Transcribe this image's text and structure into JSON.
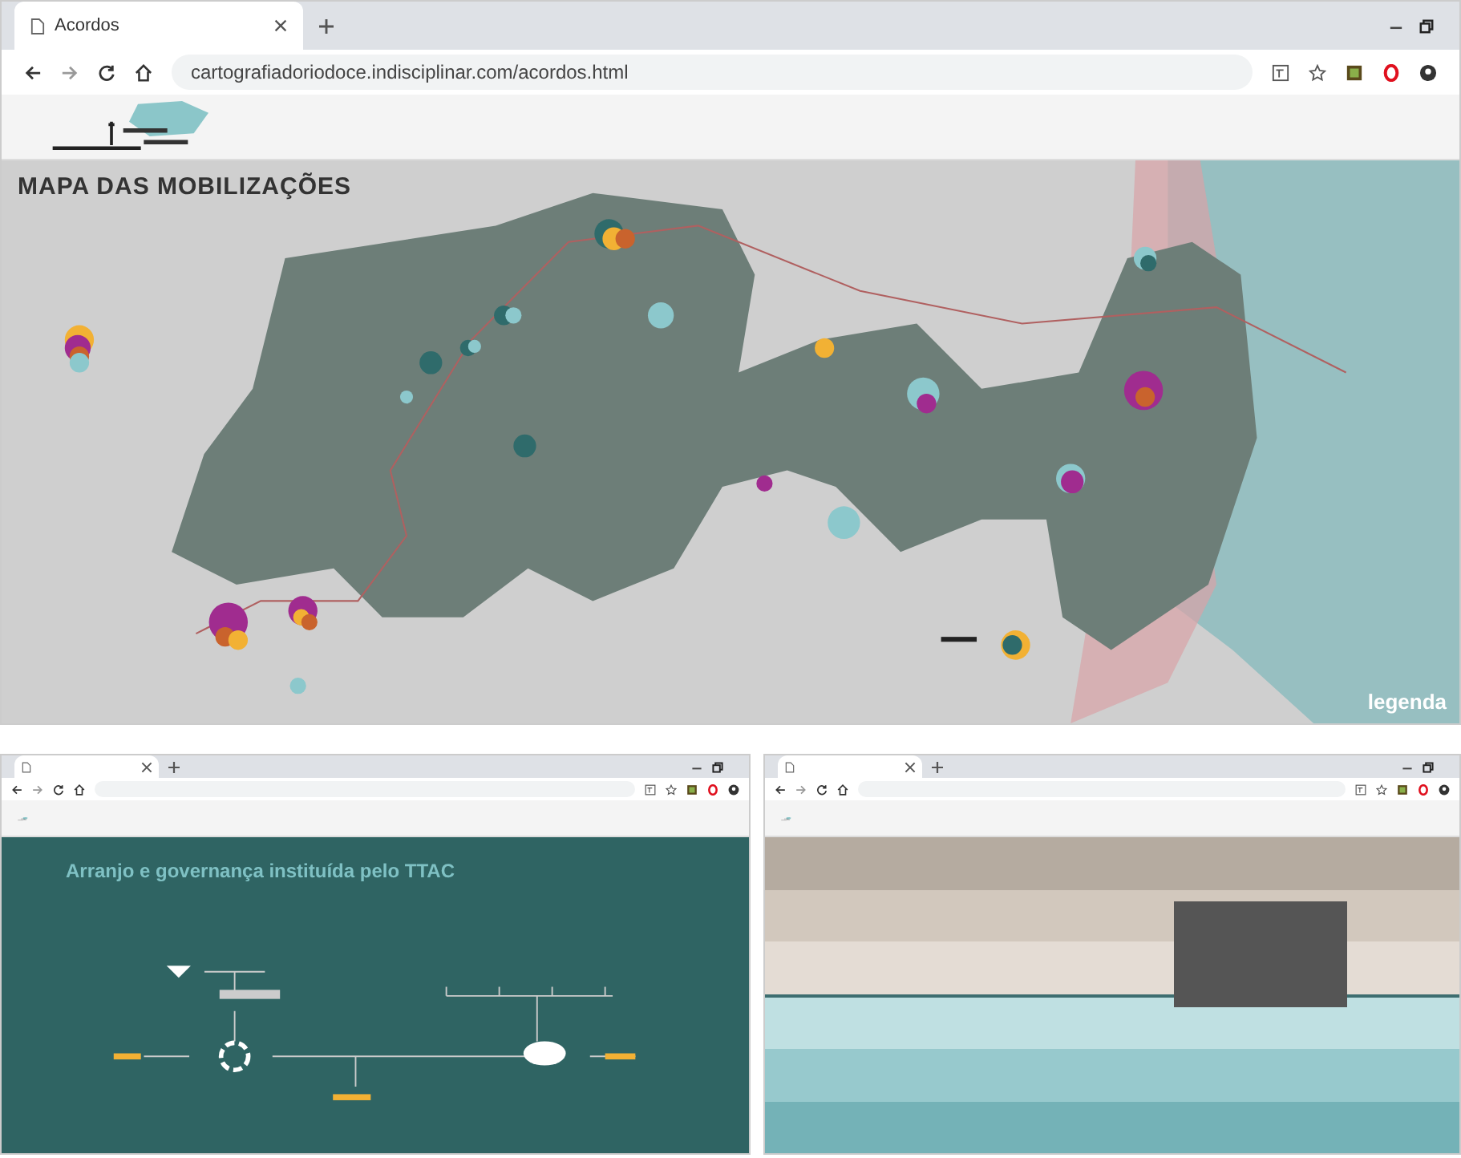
{
  "main_window": {
    "tab_title": "Acordos",
    "url": "cartografiadoriodoce.indisciplinar.com/acordos.html",
    "map_title": "MAPA DAS MOBILIZAÇÕES",
    "legend_link": "legenda"
  },
  "left_window": {
    "heading": "Arranjo e governança instituída pelo TTAC"
  }
}
